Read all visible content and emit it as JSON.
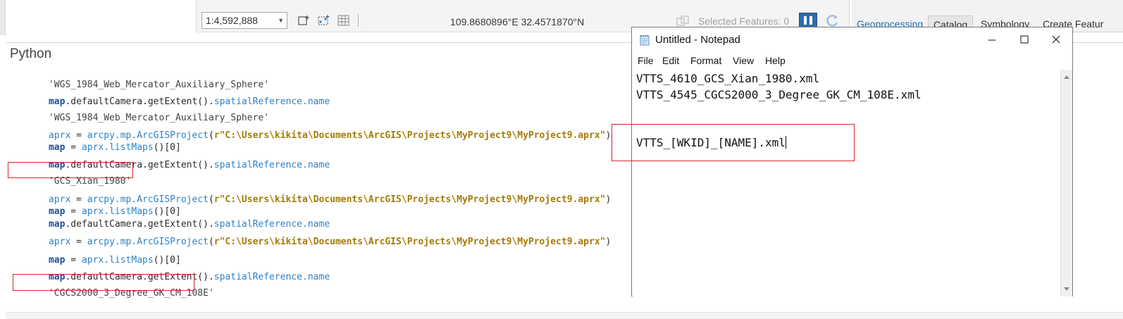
{
  "map_status": {
    "scale": "1:4,592,888",
    "coordinates": "109.8680896°E 32.4571870°N",
    "selected_features": "Selected Features: 0"
  },
  "tabs": [
    "Geoprocessing",
    "Catalog",
    "Symbology",
    "Create Featur"
  ],
  "python": {
    "title": "Python",
    "lines": {
      "l0": "'WGS_1984_Web_Mercator_Auxiliary_Sphere'",
      "l1_obj": "map",
      "l1_call": ".defaultCamera.getExtent().",
      "l1_prop": "spatialReference.name",
      "l2": "'WGS_1984_Web_Mercator_Auxiliary_Sphere'",
      "l3_var": "aprx",
      "l3_eq": " = ",
      "l3_call": "arcpy.mp.ArcGISProject",
      "l3_open": "(",
      "l3_str": "r\"C:\\Users\\kikita\\Documents\\ArcGIS\\Projects\\MyProject9\\MyProject9.aprx\"",
      "l3_close": ")",
      "l4_var": "map",
      "l4_eq": " = ",
      "l4_call": "aprx.listMaps",
      "l4_rest": "()[0]",
      "l5_obj": "map",
      "l5_call": ".defaultCamera.getExtent().",
      "l5_prop": "spatialReference.name",
      "l6": "'GCS_Xian_1980'",
      "l7_var": "aprx",
      "l7_eq": " = ",
      "l7_call": "arcpy.mp.ArcGISProject",
      "l7_open": "(",
      "l7_str": "r\"C:\\Users\\kikita\\Documents\\ArcGIS\\Projects\\MyProject9\\MyProject9.aprx\"",
      "l7_close": ")",
      "l8_var": "map",
      "l8_eq": " = ",
      "l8_call": "aprx.listMaps",
      "l8_rest": "()[0]",
      "l9_obj": "map",
      "l9_call": ".defaultCamera.getExtent().",
      "l9_prop": "spatialReference.name",
      "l10_var": "aprx",
      "l10_eq": " = ",
      "l10_call": "arcpy.mp.ArcGISProject",
      "l10_open": "(",
      "l10_str": "r\"C:\\Users\\kikita\\Documents\\ArcGIS\\Projects\\MyProject9\\MyProject9.aprx\"",
      "l10_close": ")",
      "l11_var": "map",
      "l11_eq": " = ",
      "l11_call": "aprx.listMaps",
      "l11_rest": "()[0]",
      "l12_obj": "map",
      "l12_call": ".defaultCamera.getExtent().",
      "l12_prop": "spatialReference.name",
      "l13": "'CGCS2000_3_Degree_GK_CM_108E'"
    }
  },
  "notepad": {
    "title": "Untitled - Notepad",
    "menu": [
      "File",
      "Edit",
      "Format",
      "View",
      "Help"
    ],
    "text_lines": [
      "VTTS_4610_GCS_Xian_1980.xml",
      "VTTS_4545_CGCS2000_3_Degree_GK_CM_108E.xml",
      "",
      "",
      "VTTS_[WKID]_[NAME].xml"
    ]
  },
  "colors": {
    "annotation_red": "#d6262f",
    "keyword_blue": "#1d4f9c",
    "call_blue": "#2f82c7",
    "string_gold": "#a57a06",
    "accent_blue": "#1f6fb5"
  }
}
